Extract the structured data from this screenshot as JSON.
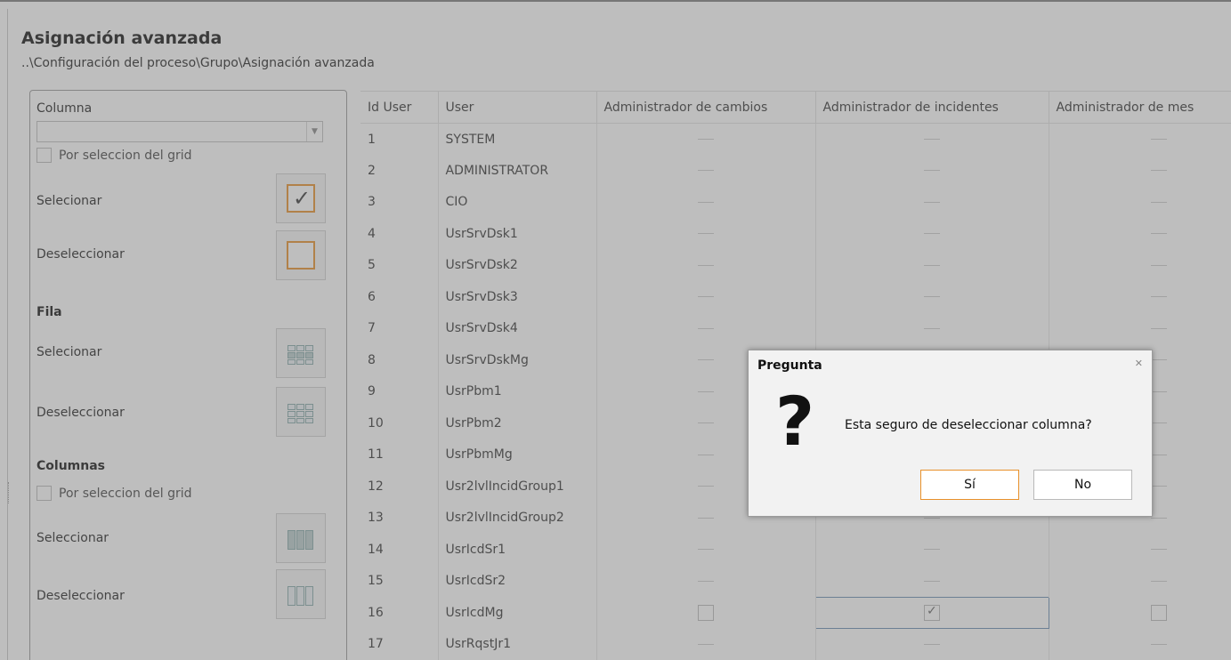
{
  "page": {
    "title": "Asignación avanzada",
    "breadcrumb": "..\\Configuración del proceso\\Grupo\\Asignación avanzada"
  },
  "panel": {
    "columna_label": "Columna",
    "combo_value": "",
    "por_seleccion_label": "Por seleccion del grid",
    "col_select_label": "Selecionar",
    "col_deselect_label": "Deseleccionar",
    "fila_heading": "Fila",
    "fila_select_label": "Selecionar",
    "fila_deselect_label": "Deseleccionar",
    "columnas_heading": "Columnas",
    "columnas_por_seleccion_label": "Por seleccion del grid",
    "columnas_select_label": "Seleccionar",
    "columnas_deselect_label": "Deseleccionar"
  },
  "grid": {
    "columns": [
      "Id User",
      "User",
      "Administrador de cambios",
      "Administrador de incidentes",
      "Administrador de mes"
    ],
    "rows": [
      {
        "id": "1",
        "user": "SYSTEM"
      },
      {
        "id": "2",
        "user": "ADMINISTRATOR"
      },
      {
        "id": "3",
        "user": "CIO"
      },
      {
        "id": "4",
        "user": "UsrSrvDsk1"
      },
      {
        "id": "5",
        "user": "UsrSrvDsk2"
      },
      {
        "id": "6",
        "user": "UsrSrvDsk3"
      },
      {
        "id": "7",
        "user": "UsrSrvDsk4"
      },
      {
        "id": "8",
        "user": "UsrSrvDskMg"
      },
      {
        "id": "9",
        "user": "UsrPbm1"
      },
      {
        "id": "10",
        "user": "UsrPbm2"
      },
      {
        "id": "11",
        "user": "UsrPbmMg"
      },
      {
        "id": "12",
        "user": "Usr2lvlIncidGroup1"
      },
      {
        "id": "13",
        "user": "Usr2lvlIncidGroup2"
      },
      {
        "id": "14",
        "user": "UsrIcdSr1"
      },
      {
        "id": "15",
        "user": "UsrIcdSr2"
      },
      {
        "id": "16",
        "user": "UsrIcdMg"
      },
      {
        "id": "17",
        "user": "UsrRqstJr1"
      }
    ]
  },
  "dialog": {
    "title": "Pregunta",
    "close_glyph": "✕",
    "icon": "question-mark-icon",
    "message": "Esta seguro de deseleccionar columna?",
    "yes_label": "Sí",
    "no_label": "No"
  },
  "colors": {
    "accent": "#e8902a",
    "selection_border": "#6a8fb3"
  }
}
